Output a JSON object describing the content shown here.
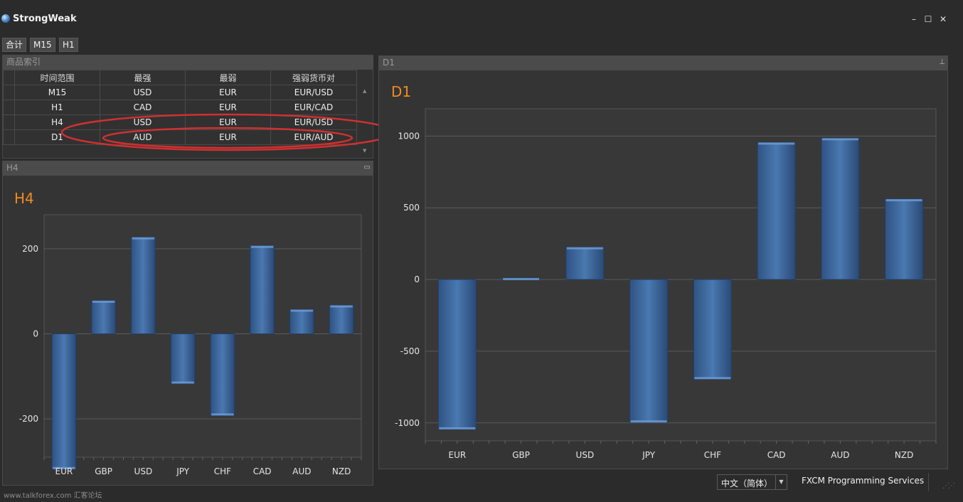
{
  "app": {
    "title": "StrongWeak"
  },
  "window_controls": {
    "minimize": "–",
    "maximize": "☐",
    "close": "✕"
  },
  "toolbar": {
    "buttons": [
      "合计",
      "M15",
      "H1"
    ]
  },
  "index_panel": {
    "title": "商品索引",
    "columns": [
      "时间范围",
      "最强",
      "最弱",
      "强弱货币对"
    ],
    "rows": [
      [
        "M15",
        "USD",
        "EUR",
        "EUR/USD"
      ],
      [
        "H1",
        "CAD",
        "EUR",
        "EUR/CAD"
      ],
      [
        "H4",
        "USD",
        "EUR",
        "EUR/USD"
      ],
      [
        "D1",
        "AUD",
        "EUR",
        "EUR/AUD"
      ]
    ]
  },
  "h4_panel": {
    "header": "H4",
    "icon": "restore-icon"
  },
  "d1_panel": {
    "header": "D1",
    "icon": "pin-icon"
  },
  "chart_data": [
    {
      "type": "bar",
      "title": "H4",
      "categories": [
        "EUR",
        "GBP",
        "USD",
        "JPY",
        "CHF",
        "CAD",
        "AUD",
        "NZD"
      ],
      "values": [
        -318,
        78,
        227,
        -117,
        -192,
        207,
        57,
        67
      ],
      "ylim": [
        -290,
        280
      ],
      "yticks": [
        -200,
        0,
        200
      ],
      "grid": true,
      "bar_color": "#4a78b0"
    },
    {
      "type": "bar",
      "title": "D1",
      "categories": [
        "EUR",
        "GBP",
        "USD",
        "JPY",
        "CHF",
        "CAD",
        "AUD",
        "NZD"
      ],
      "values": [
        -1045,
        10,
        225,
        -997,
        -695,
        955,
        985,
        560
      ],
      "ylim": [
        -1125,
        1190
      ],
      "yticks": [
        -1000,
        -500,
        0,
        500,
        1000
      ],
      "grid": true,
      "bar_color": "#4a78b0"
    }
  ],
  "footer": {
    "language": "中文（简体）",
    "services": "FXCM Programming Services",
    "watermark": "www.talkforex.com 汇客论坛"
  }
}
